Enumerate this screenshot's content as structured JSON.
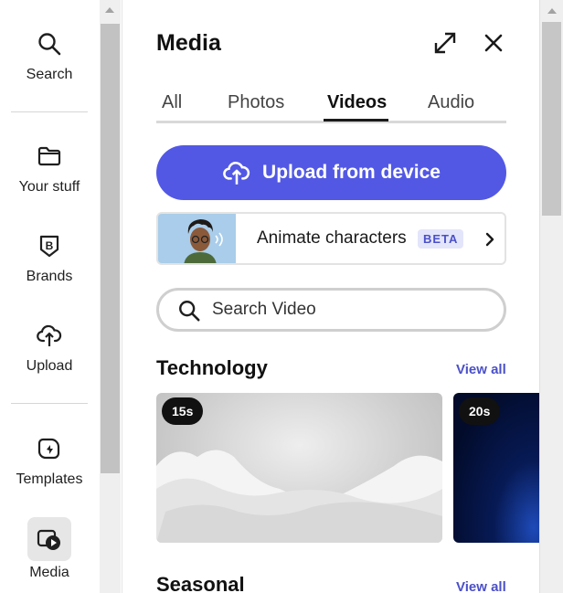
{
  "rail": {
    "items": [
      {
        "label": "Search",
        "icon": "search-icon"
      },
      {
        "label": "Your stuff",
        "icon": "folder-icon"
      },
      {
        "label": "Brands",
        "icon": "brand-icon"
      },
      {
        "label": "Upload",
        "icon": "cloud-upload-icon"
      },
      {
        "label": "Templates",
        "icon": "templates-icon"
      },
      {
        "label": "Media",
        "icon": "media-icon",
        "active": true
      }
    ]
  },
  "panel": {
    "title": "Media",
    "tabs": [
      {
        "label": "All"
      },
      {
        "label": "Photos"
      },
      {
        "label": "Videos",
        "active": true
      },
      {
        "label": "Audio"
      }
    ],
    "upload_label": "Upload from device",
    "animate": {
      "label": "Animate characters",
      "badge": "BETA"
    },
    "search": {
      "placeholder": "Search Video"
    },
    "sections": [
      {
        "title": "Technology",
        "view_all": "View all",
        "videos": [
          {
            "duration": "15s"
          },
          {
            "duration": "20s"
          }
        ]
      },
      {
        "title": "Seasonal",
        "view_all": "View all"
      }
    ]
  },
  "colors": {
    "accent": "#5258e4",
    "link": "#4b50c8",
    "beta_bg": "#e3e5fb"
  }
}
